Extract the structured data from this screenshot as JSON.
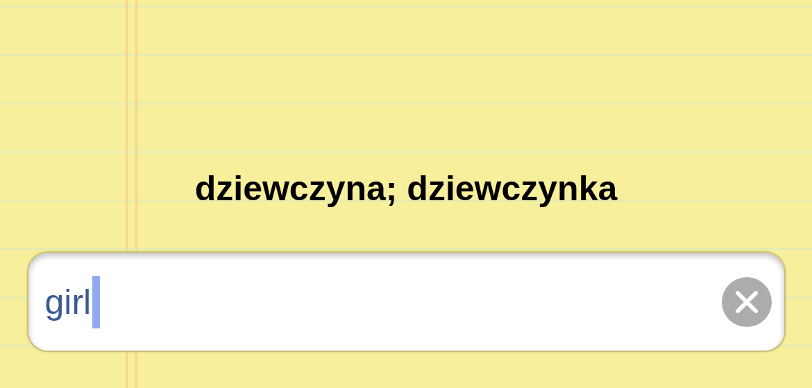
{
  "translation": "dziewczyna; dziewczynka",
  "answer_field": {
    "value": "girl"
  }
}
